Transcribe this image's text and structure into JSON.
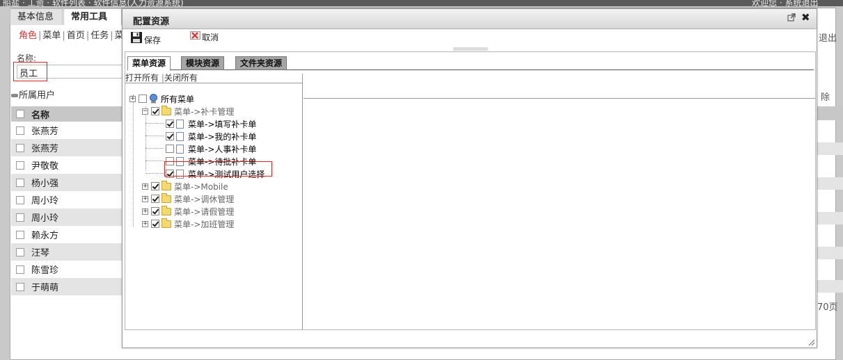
{
  "topbar": {
    "left_text": "船盐 · 工资 · 软件列表 · 软件信息(人力资源系统)",
    "right_text": "欢迎您 · 系统退出"
  },
  "app": {
    "tabs": [
      {
        "label": "基本信息"
      },
      {
        "label": "常用工具"
      }
    ],
    "links": [
      {
        "label": "角色"
      },
      {
        "label": "菜单"
      },
      {
        "label": "首页"
      },
      {
        "label": "任务"
      },
      {
        "label": "菜"
      }
    ],
    "name_label": "名称:",
    "name_value": "员工",
    "users_title": "所属用户",
    "users_header": "名称",
    "users": [
      {
        "name": "张燕芳"
      },
      {
        "name": "张燕芳"
      },
      {
        "name": "尹敬敬"
      },
      {
        "name": "杨小强"
      },
      {
        "name": "周小玲"
      },
      {
        "name": "周小玲"
      },
      {
        "name": "赖永方"
      },
      {
        "name": "汪琴"
      },
      {
        "name": "陈雪珍"
      },
      {
        "name": "于萌萌"
      }
    ],
    "right_exit": "退出",
    "right_delete": "除",
    "right_pages": "70页"
  },
  "modal": {
    "title": "配置资源",
    "save_label": "保存",
    "cancel_label": "取消",
    "tabs": [
      {
        "label": "菜单资源"
      },
      {
        "label": "模块资源"
      },
      {
        "label": "文件夹资源"
      }
    ],
    "open_all": "打开所有",
    "close_all": "关闭所有",
    "tree": {
      "root": "所有菜单",
      "group1": "菜单->补卡管理",
      "children": [
        "菜单->填写补卡单",
        "菜单->我的补卡单",
        "菜单->人事补卡单",
        "菜单->待批补卡单",
        "菜单->测试用户选择"
      ],
      "others": [
        "菜单->Mobile",
        "菜单->调休管理",
        "菜单->请假管理",
        "菜单->加班管理"
      ]
    }
  },
  "colors": {
    "highlight_red": "#dd2222",
    "tab_grey": "#a5a5a5",
    "folder_yellow": "#f4d870"
  }
}
